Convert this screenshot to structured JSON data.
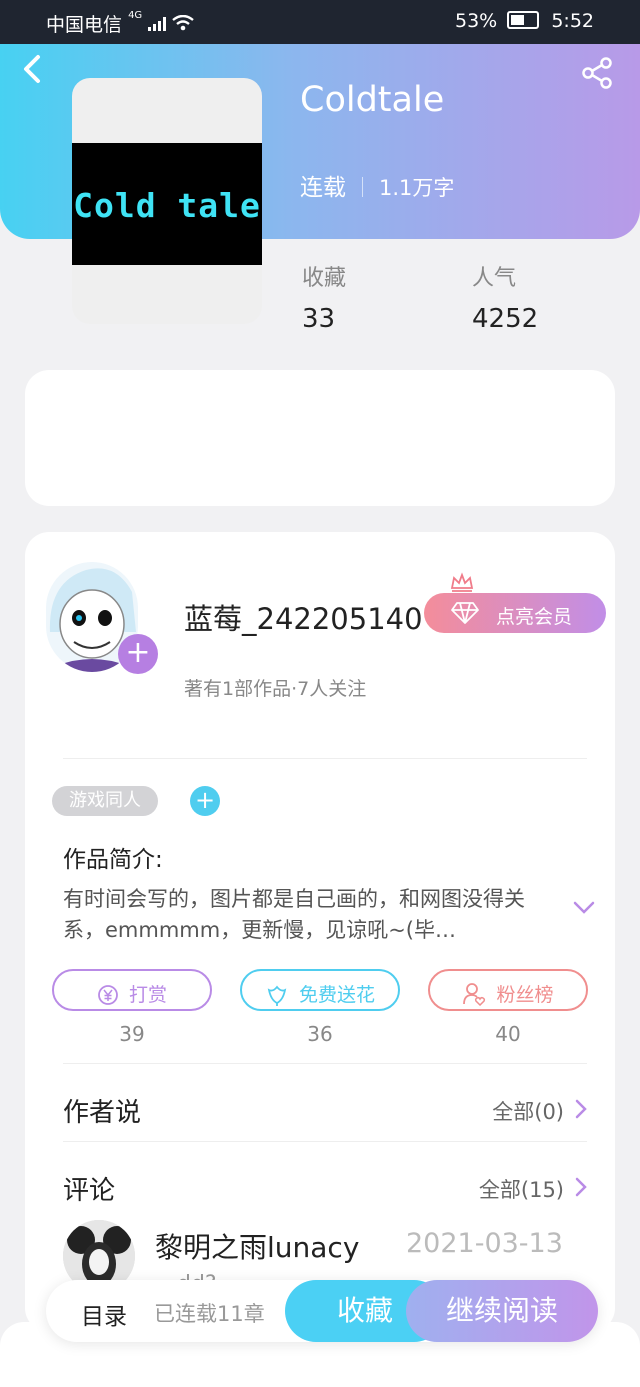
{
  "status_bar": {
    "carrier": "中国电信",
    "network": "4G",
    "battery": "53%",
    "time": "5:52"
  },
  "book": {
    "cover_text": "Cold tale",
    "title": "Coldtale",
    "serial_status": "连载",
    "word_count": "1.1万字",
    "favorites_label": "收藏",
    "favorites_value": "33",
    "popularity_label": "人气",
    "popularity_value": "4252"
  },
  "author": {
    "name": "蓝莓_242205140",
    "meta": "著有1部作品·7人关注",
    "vip_button": "点亮会员"
  },
  "tags": [
    "游戏同人"
  ],
  "intro": {
    "title": "作品简介:",
    "text": "有时间会写的，图片都是自己画的，和网图没得关系，emmmmm，更新慢，见谅吼~(毕…"
  },
  "actions": [
    {
      "label": "打赏",
      "count": "39",
      "color": "#b98be6"
    },
    {
      "label": "免费送花",
      "count": "36",
      "color": "#4fcdef"
    },
    {
      "label": "粉丝榜",
      "count": "40",
      "color": "#f08e8e"
    }
  ],
  "author_says": {
    "title": "作者说",
    "more": "全部(0)"
  },
  "comments": {
    "title": "评论",
    "more": "全部(15)",
    "first": {
      "user": "黎明之雨lunacy",
      "date": "2021-03-13",
      "text": "…dd?"
    }
  },
  "bottom_bar": {
    "toc": "目录",
    "toc_sub": "已连载11章",
    "collect": "收藏",
    "continue": "继续阅读"
  },
  "colors": {
    "header_gradient_start": "#47d1f2",
    "header_gradient_end": "#b89ae8",
    "accent_blue": "#4bd0f4",
    "accent_purple": "#c195ea"
  }
}
